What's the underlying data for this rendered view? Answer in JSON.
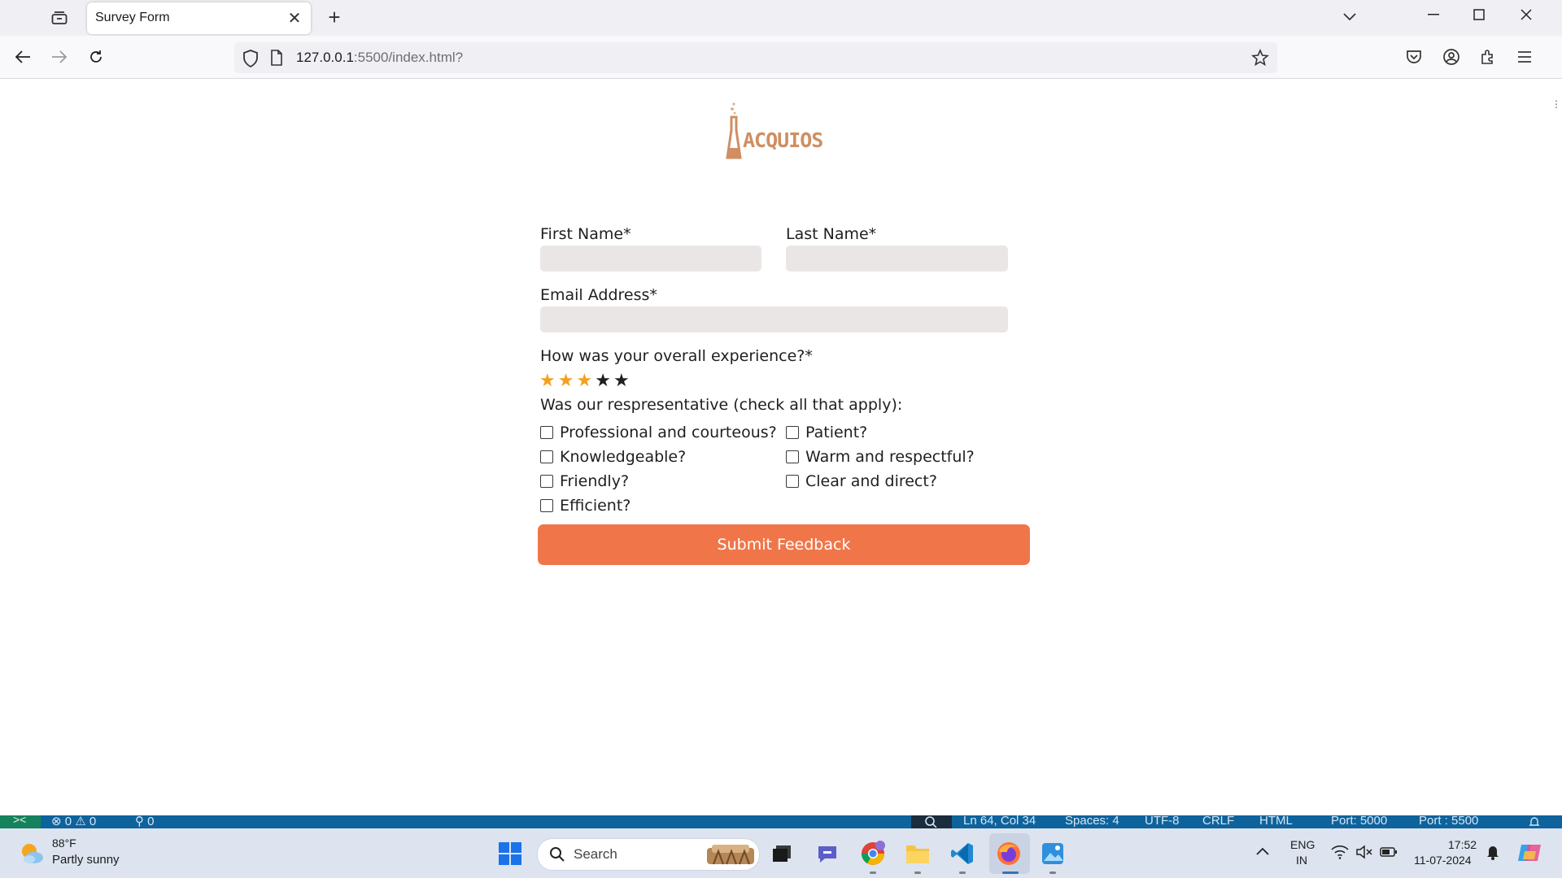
{
  "browser": {
    "tab_title": "Survey Form",
    "url_host": "127.0.0.1",
    "url_rest": ":5500/index.html?"
  },
  "logo": {
    "text": "ACQUIOS"
  },
  "form": {
    "first_name_label": "First Name*",
    "last_name_label": "Last Name*",
    "email_label": "Email Address*",
    "rating_label": "How was your overall experience?*",
    "rating": {
      "value": 3,
      "max": 5,
      "filled_color": "#f2a11f",
      "empty_color": "#1f1f1f"
    },
    "rep_label": "Was our respresentative (check all that apply):",
    "checkboxes_left": [
      "Professional and courteous?",
      "Knowledgeable?",
      "Friendly?",
      "Efficient?"
    ],
    "checkboxes_right": [
      "Patient?",
      "Warm and respectful?",
      "Clear and direct?"
    ],
    "submit_label": "Submit Feedback",
    "submit_color": "#f07649"
  },
  "vscode_status": {
    "problems": "⊗ 0 ⚠ 0",
    "ports": "⚲ 0",
    "cursor": "Ln 64, Col 34",
    "spaces": "Spaces: 4",
    "encoding": "UTF-8",
    "eol": "CRLF",
    "language": "HTML",
    "port_a": "Port: 5000",
    "port_b": "Port : 5500"
  },
  "taskbar": {
    "weather_temp": "88°F",
    "weather_desc": "Partly sunny",
    "search_placeholder": "Search",
    "lang_top": "ENG",
    "lang_bottom": "IN",
    "time": "17:52",
    "date": "11-07-2024"
  }
}
